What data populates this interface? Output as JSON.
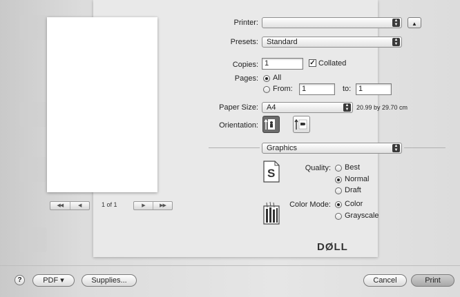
{
  "preview": {
    "page_count": "1 of 1",
    "pager_first": "◀◀",
    "pager_prev": "◀",
    "pager_next": "▶",
    "pager_last": "▶▶"
  },
  "printer": {
    "label": "Printer:",
    "value": ""
  },
  "presets": {
    "label": "Presets:",
    "value": "Standard"
  },
  "copies": {
    "label": "Copies:",
    "value": "1",
    "collated_label": "Collated",
    "collated": true
  },
  "pages": {
    "label": "Pages:",
    "all_label": "All",
    "from_label": "From:",
    "from_value": "1",
    "to_label": "to:",
    "to_value": "1",
    "selected": "All"
  },
  "paper_size": {
    "label": "Paper Size:",
    "value": "A4",
    "dimensions": "20.99 by 29.70 cm"
  },
  "orientation": {
    "label": "Orientation:",
    "selected": "portrait"
  },
  "section": {
    "value": "Graphics"
  },
  "quality": {
    "label": "Quality:",
    "options": [
      "Best",
      "Normal",
      "Draft"
    ],
    "selected": "Normal"
  },
  "color_mode": {
    "label": "Color Mode:",
    "options": [
      "Color",
      "Grayscale"
    ],
    "selected": "Color"
  },
  "brand": {
    "logo_text": "DØLL"
  },
  "footer": {
    "help_label": "?",
    "pdf_label": "PDF ▾",
    "supplies_label": "Supplies...",
    "cancel_label": "Cancel",
    "print_label": "Print"
  },
  "icons": {
    "disclosure": "triangle-up-icon",
    "quality": "s-document-icon",
    "color": "ink-bottles-icon"
  }
}
